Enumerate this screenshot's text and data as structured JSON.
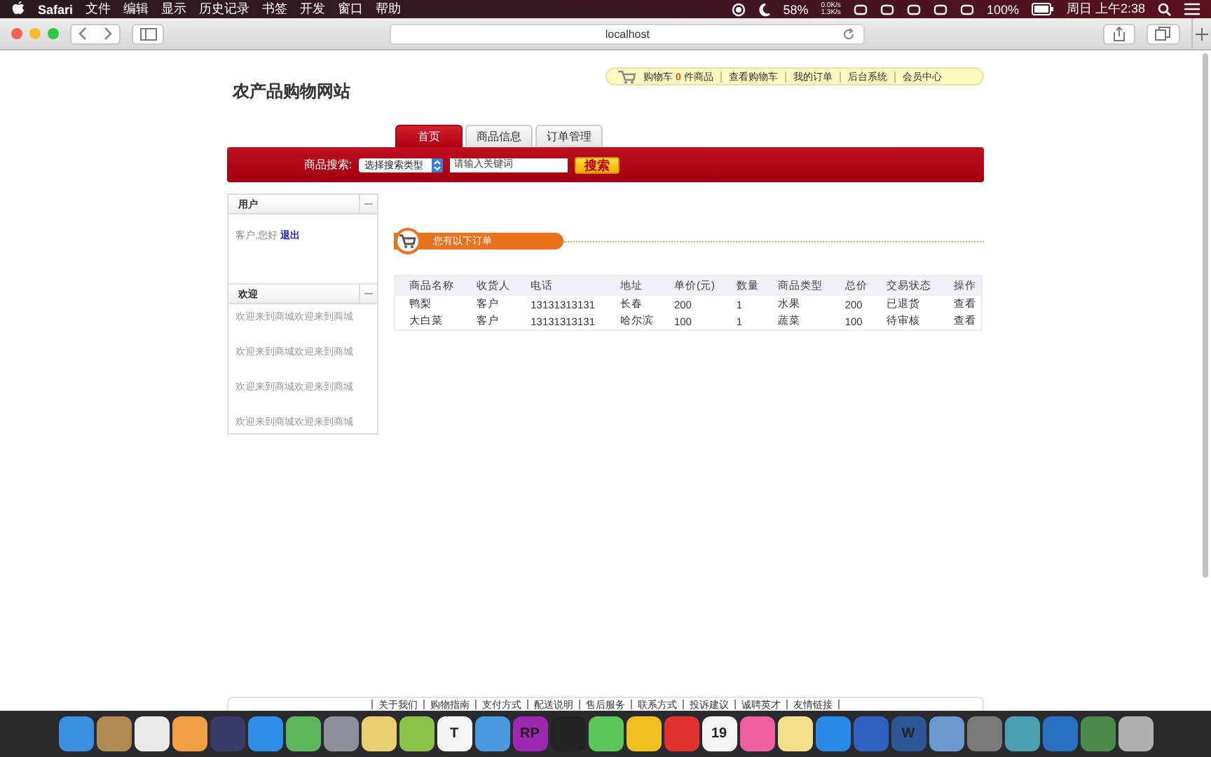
{
  "menu_bar": {
    "app": "Safari",
    "menus": [
      "文件",
      "编辑",
      "显示",
      "历史记录",
      "书签",
      "开发",
      "窗口",
      "帮助"
    ],
    "battery_saver": "58%",
    "net_up": "0.0K/s",
    "net_down": "1.3K/s",
    "battery": "100%",
    "clock": "周日 上午2:38"
  },
  "browser": {
    "address": "localhost"
  },
  "site": {
    "title": "农产品购物网站",
    "cart": {
      "label": "购物车",
      "count": "0",
      "unit": "件商品"
    },
    "top_links": [
      "查看购物车",
      "我的订单",
      "后台系统",
      "会员中心"
    ],
    "tabs": [
      {
        "label": "首页",
        "selected": true
      },
      {
        "label": "商品信息",
        "selected": false
      },
      {
        "label": "订单管理",
        "selected": false
      }
    ],
    "search": {
      "label": "商品搜索:",
      "select": "选择搜索类型",
      "placeholder": "请输入关键词",
      "button": "搜索"
    },
    "user_panel": {
      "title": "用户",
      "greeting": "客户,您好",
      "logout": "退出"
    },
    "welcome_panel": {
      "title": "欢迎",
      "lines": [
        "欢迎来到商城欢迎来到商城",
        "欢迎来到商城欢迎来到商城",
        "欢迎来到商城欢迎来到商城",
        "欢迎来到商城欢迎来到商城"
      ]
    },
    "orders_banner": "您有以下订单",
    "table": {
      "columns": [
        "商品名称",
        "收货人",
        "电话",
        "地址",
        "单价(元)",
        "数量",
        "商品类型",
        "总价",
        "交易状态",
        "操作"
      ],
      "rows": [
        [
          "鸭梨",
          "客户",
          "13131313131",
          "长春",
          "200",
          "1",
          "水果",
          "200",
          "已退货",
          "查看"
        ],
        [
          "大白菜",
          "客户",
          "13131313131",
          "哈尔滨",
          "100",
          "1",
          "蔬菜",
          "100",
          "待审核",
          "查看"
        ]
      ]
    },
    "footer_links": [
      "关于我们",
      "购物指南",
      "支付方式",
      "配送说明",
      "售后服务",
      "联系方式",
      "投诉建议",
      "诚聘英才",
      "友情链接"
    ]
  },
  "dock": [
    {
      "color": "#3a8fe0"
    },
    {
      "color": "#b08a50"
    },
    {
      "color": "#e8e8e8"
    },
    {
      "color": "#f0a040"
    },
    {
      "color": "#3a3a6a"
    },
    {
      "color": "#2f8fe8"
    },
    {
      "color": "#5cb85c"
    },
    {
      "color": "#8a8f99"
    },
    {
      "color": "#e8d070"
    },
    {
      "color": "#8bc34a"
    },
    {
      "color": "#f4f4f4",
      "text": "T"
    },
    {
      "color": "#4a9ae0"
    },
    {
      "color": "#9c27b0",
      "text": "RP"
    },
    {
      "color": "#222222"
    },
    {
      "color": "#5cc85c"
    },
    {
      "color": "#f0c020"
    },
    {
      "color": "#e03030"
    },
    {
      "color": "#f4f4f4",
      "text": "19"
    },
    {
      "color": "#f060a0"
    },
    {
      "color": "#f4e08a"
    },
    {
      "color": "#2a8ae8"
    },
    {
      "color": "#3060c0"
    },
    {
      "color": "#2b5797",
      "text": "W"
    },
    {
      "color": "#6a9ad0"
    },
    {
      "color": "#7a7a7a"
    },
    {
      "color": "#4aa0b0"
    },
    {
      "color": "#2a70c0"
    },
    {
      "color": "#4a8a4a"
    },
    {
      "color": "#b0b0b0"
    }
  ]
}
